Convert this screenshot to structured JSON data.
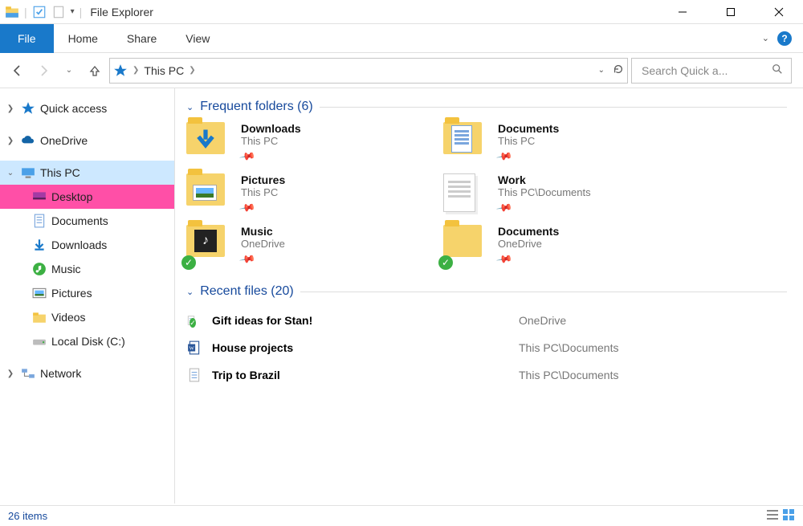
{
  "window": {
    "title": "File Explorer"
  },
  "ribbon": {
    "file": "File",
    "tabs": [
      "Home",
      "Share",
      "View"
    ]
  },
  "breadcrumb": {
    "root": "This PC"
  },
  "search": {
    "placeholder": "Search Quick a..."
  },
  "sidebar": {
    "quick_access": "Quick access",
    "onedrive": "OneDrive",
    "this_pc": "This PC",
    "children": [
      "Desktop",
      "Documents",
      "Downloads",
      "Music",
      "Pictures",
      "Videos",
      "Local Disk (C:)"
    ],
    "network": "Network"
  },
  "sections": {
    "frequent": {
      "label": "Frequent folders",
      "count": 6
    },
    "recent": {
      "label": "Recent files",
      "count": 20
    }
  },
  "frequent_folders": [
    {
      "name": "Downloads",
      "sub": "This PC",
      "variant": "downloads"
    },
    {
      "name": "Documents",
      "sub": "This PC",
      "variant": "documents"
    },
    {
      "name": "Pictures",
      "sub": "This PC",
      "variant": "pictures"
    },
    {
      "name": "Work",
      "sub": "This PC\\Documents",
      "variant": "work"
    },
    {
      "name": "Music",
      "sub": "OneDrive",
      "variant": "music",
      "sync": true
    },
    {
      "name": "Documents",
      "sub": "OneDrive",
      "variant": "plain",
      "sync": true
    }
  ],
  "recent_files": [
    {
      "name": "Gift ideas for Stan!",
      "path": "OneDrive",
      "icon": "text",
      "sync": true
    },
    {
      "name": "House projects",
      "path": "This PC\\Documents",
      "icon": "word"
    },
    {
      "name": "Trip to Brazil",
      "path": "This PC\\Documents",
      "icon": "text"
    }
  ],
  "status": {
    "items_label": "26 items"
  }
}
